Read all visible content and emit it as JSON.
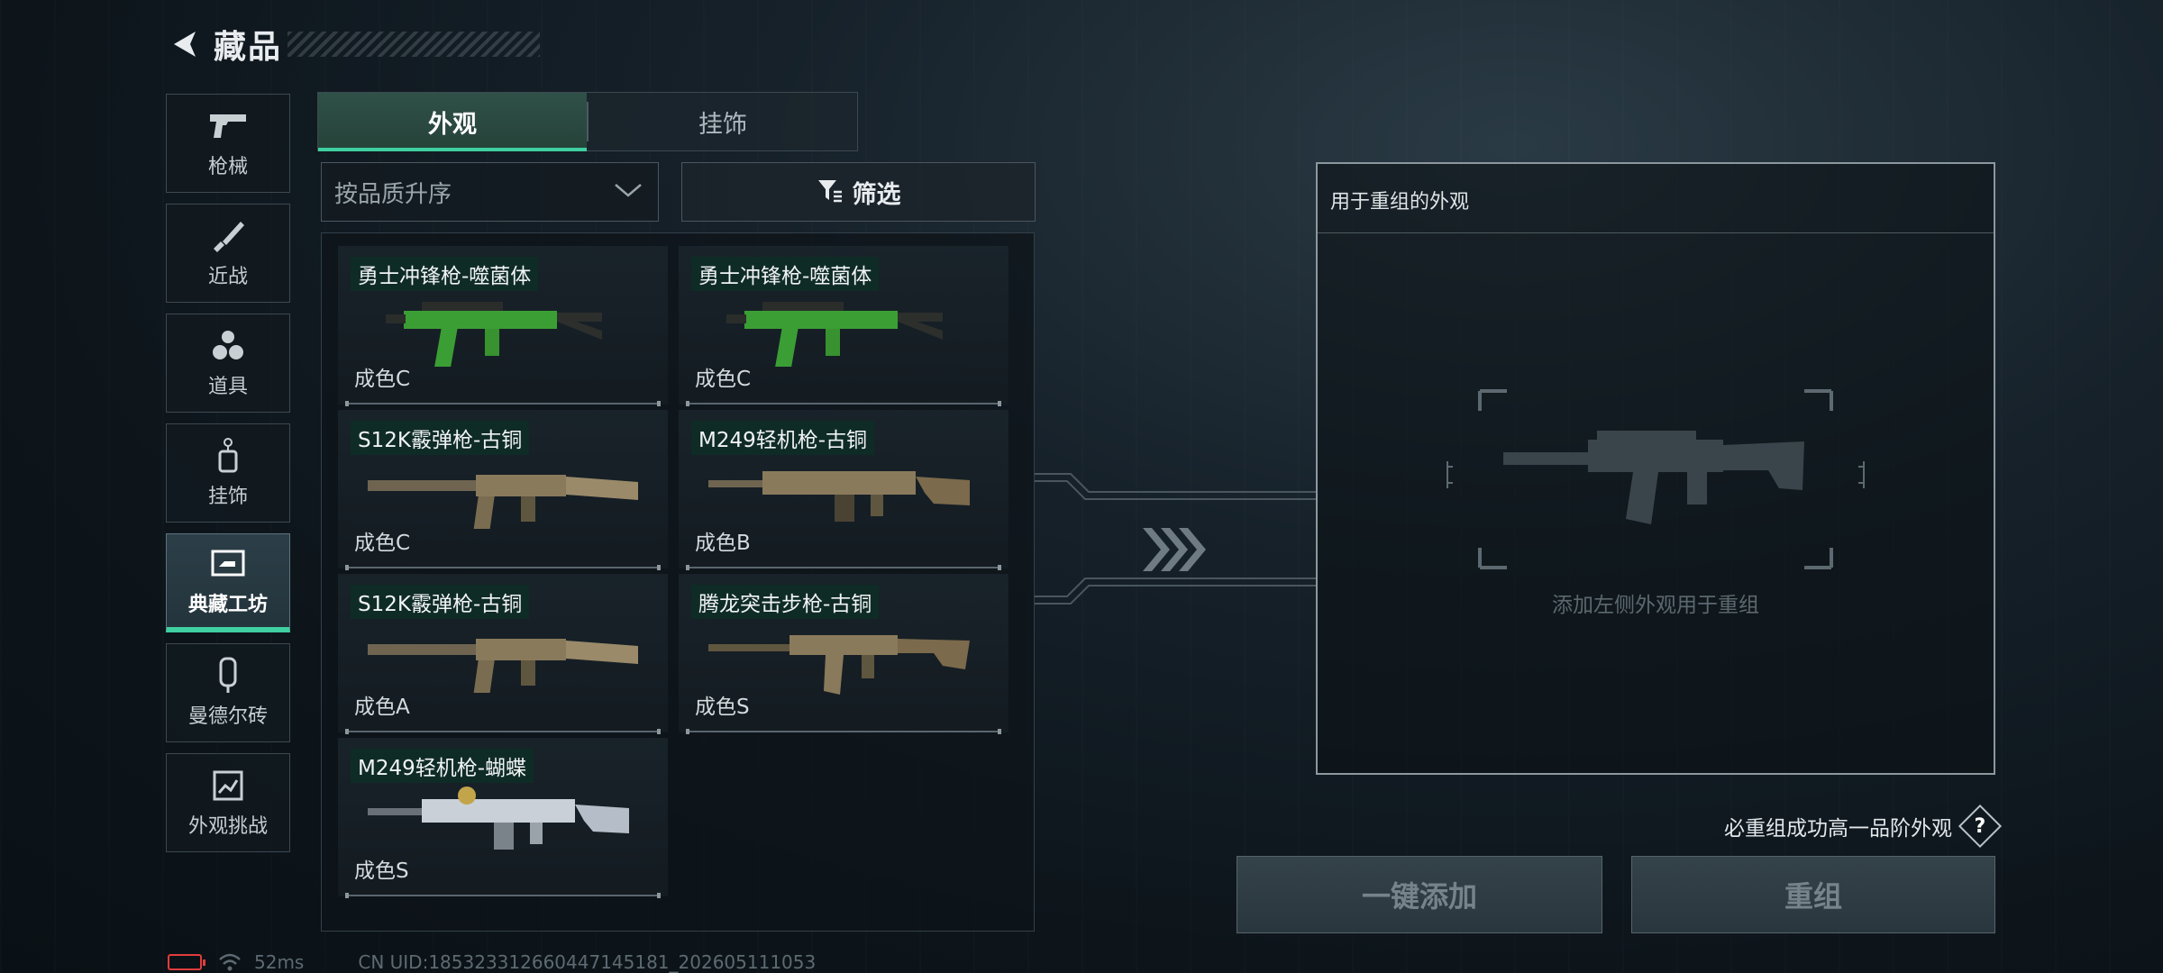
{
  "header": {
    "title": "藏品"
  },
  "rail": {
    "items": [
      {
        "label": "枪械",
        "icon": "pistol-icon"
      },
      {
        "label": "近战",
        "icon": "knife-icon"
      },
      {
        "label": "道具",
        "icon": "grenade-icon"
      },
      {
        "label": "挂饰",
        "icon": "charm-icon"
      },
      {
        "label": "典藏工坊",
        "icon": "workshop-icon",
        "active": true
      },
      {
        "label": "曼德尔砖",
        "icon": "brick-icon"
      },
      {
        "label": "外观挑战",
        "icon": "challenge-icon"
      }
    ]
  },
  "tabs": [
    {
      "label": "外观",
      "active": true
    },
    {
      "label": "挂饰",
      "active": false
    }
  ],
  "sort": {
    "label": "按品质升序"
  },
  "filter": {
    "label": "筛选"
  },
  "cards": [
    {
      "name": "勇士冲锋枪-噬菌体",
      "grade": "成色C",
      "skin": "green",
      "gun": "smg"
    },
    {
      "name": "勇士冲锋枪-噬菌体",
      "grade": "成色C",
      "skin": "green",
      "gun": "smg"
    },
    {
      "name": "S12K霰弹枪-古铜",
      "grade": "成色C",
      "skin": "bronze",
      "gun": "shotgun"
    },
    {
      "name": "M249轻机枪-古铜",
      "grade": "成色B",
      "skin": "bronze",
      "gun": "lmg"
    },
    {
      "name": "S12K霰弹枪-古铜",
      "grade": "成色A",
      "skin": "bronze",
      "gun": "shotgun"
    },
    {
      "name": "腾龙突击步枪-古铜",
      "grade": "成色S",
      "skin": "bronze",
      "gun": "rifle"
    },
    {
      "name": "M249轻机枪-蝴蝶",
      "grade": "成色S",
      "skin": "white",
      "gun": "lmg"
    }
  ],
  "recombine": {
    "title": "用于重组的外观",
    "hint": "添加左侧外观用于重组",
    "bonus_text": "必重组成功高一品阶外观",
    "help_label": "?"
  },
  "buttons": {
    "add_label": "一键添加",
    "recombine_label": "重组"
  },
  "status": {
    "ping": "52ms",
    "uid": "CN UID:185323312660447145181_202605111053"
  },
  "colors": {
    "accent": "#3fcfa0",
    "skin_green": "#3fa33a",
    "skin_bronze": "#8a7a5c",
    "skin_white": "#c9d0d8"
  }
}
